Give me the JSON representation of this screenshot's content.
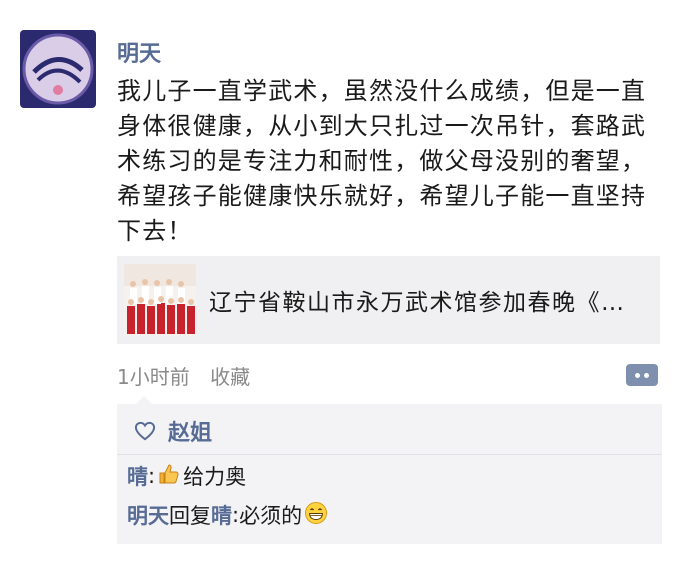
{
  "post": {
    "author": "明天",
    "text": "我儿子一直学武术，虽然没什么成绩，但是一直身体很健康，从小到大只扎过一次吊针，套路武术练习的是专注力和耐性，做父母没别的奢望，希望孩子能健康快乐就好，希望儿子能一直坚持下去！",
    "link_title": "辽宁省鞍山市永万武术馆参加春晚《…",
    "time": "1小时前",
    "favorite": "收藏"
  },
  "likes": {
    "names": "赵姐"
  },
  "comments": [
    {
      "nick": "晴",
      "sep": ": ",
      "text": "给力奥",
      "emoji": "thumbs-up-emoji"
    },
    {
      "nick": "明天",
      "reply_word": "回复",
      "target": "晴",
      "sep": ": ",
      "text": "必须的",
      "emoji": "grinning-emoji"
    }
  ],
  "colors": {
    "nickname": "#576b95",
    "card_bg": "#f0f0f2",
    "comment_bg": "#f3f3f5",
    "more_button": "#7f8fae"
  }
}
